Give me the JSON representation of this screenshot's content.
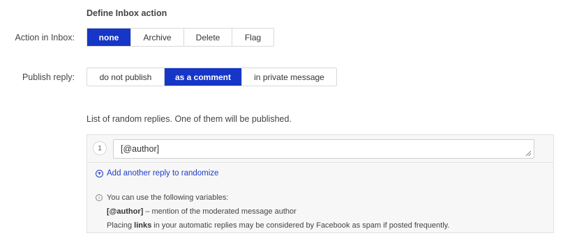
{
  "inbox_section": {
    "title": "Define Inbox action",
    "label": "Action in Inbox:",
    "options": [
      "none",
      "Archive",
      "Delete",
      "Flag"
    ],
    "selected": "none"
  },
  "publish_section": {
    "label": "Publish reply:",
    "options": [
      "do not publish",
      "as a comment",
      "in private message"
    ],
    "selected": "as a comment"
  },
  "replies": {
    "title": "List of random replies. One of them will be published.",
    "items": [
      {
        "number": "1",
        "text": "[@author]"
      }
    ],
    "add_label": "Add another reply to randomize"
  },
  "info": {
    "icon_glyph": "i",
    "intro": "You can use the following variables:",
    "variable_name": "[@author]",
    "variable_desc": " – mention of the moderated message author",
    "spam_prefix": "Placing ",
    "spam_bold": "links",
    "spam_suffix": " in your automatic replies may be considered by Facebook as spam if posted frequently."
  },
  "colors": {
    "accent": "#1636c7",
    "link": "#1d3dc9"
  },
  "icons": {
    "add": "plus-circle-icon",
    "info": "info-circle-icon",
    "resize": "resize-grip-icon"
  }
}
